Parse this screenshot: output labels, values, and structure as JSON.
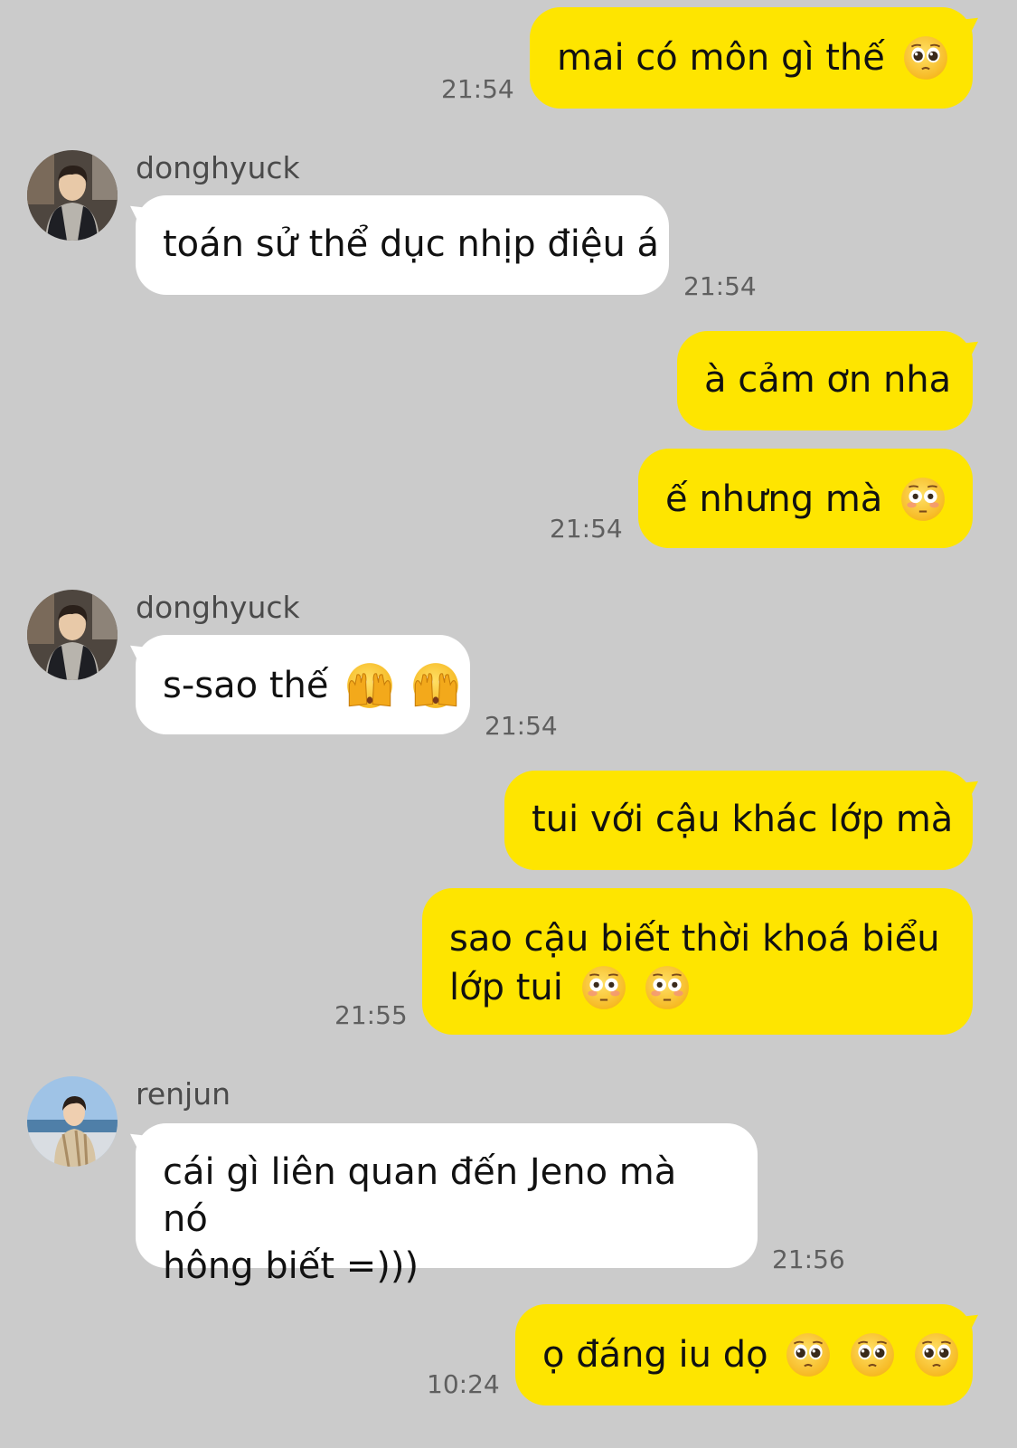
{
  "messages": [
    {
      "id": "m1",
      "side": "me",
      "text": "mai có môn gì thế",
      "emojis": [
        "pleading"
      ],
      "time": "21:54"
    },
    {
      "id": "m2",
      "side": "them",
      "sender": "donghyuck",
      "text": "toán sử thể dục nhịp điệu á",
      "time": "21:54"
    },
    {
      "id": "m3",
      "side": "me",
      "text": "à cảm ơn nha"
    },
    {
      "id": "m4",
      "side": "me",
      "text": "ế nhưng mà",
      "emojis": [
        "flushed"
      ],
      "time": "21:54"
    },
    {
      "id": "m5",
      "side": "them",
      "sender": "donghyuck",
      "text": "s-sao thế",
      "emojis": [
        "peeking",
        "peeking"
      ],
      "time": "21:54"
    },
    {
      "id": "m6",
      "side": "me",
      "text": "tui với cậu khác lớp mà"
    },
    {
      "id": "m7",
      "side": "me",
      "line1": "sao cậu biết thời khoá biểu",
      "line2": "lớp tui",
      "emojis": [
        "flushed",
        "flushed"
      ],
      "time": "21:55"
    },
    {
      "id": "m8",
      "side": "them",
      "sender": "renjun",
      "line1": "cái gì liên quan đến Jeno mà nó",
      "line2": "hông biết =)))",
      "time": "21:56"
    },
    {
      "id": "m9",
      "side": "me",
      "text": "ọ đáng iu dọ",
      "emojis": [
        "pleading",
        "pleading",
        "pleading"
      ],
      "time": "10:24"
    }
  ],
  "colors": {
    "background": "#cbcbcb",
    "my_bubble": "#fee500",
    "their_bubble": "#ffffff"
  }
}
